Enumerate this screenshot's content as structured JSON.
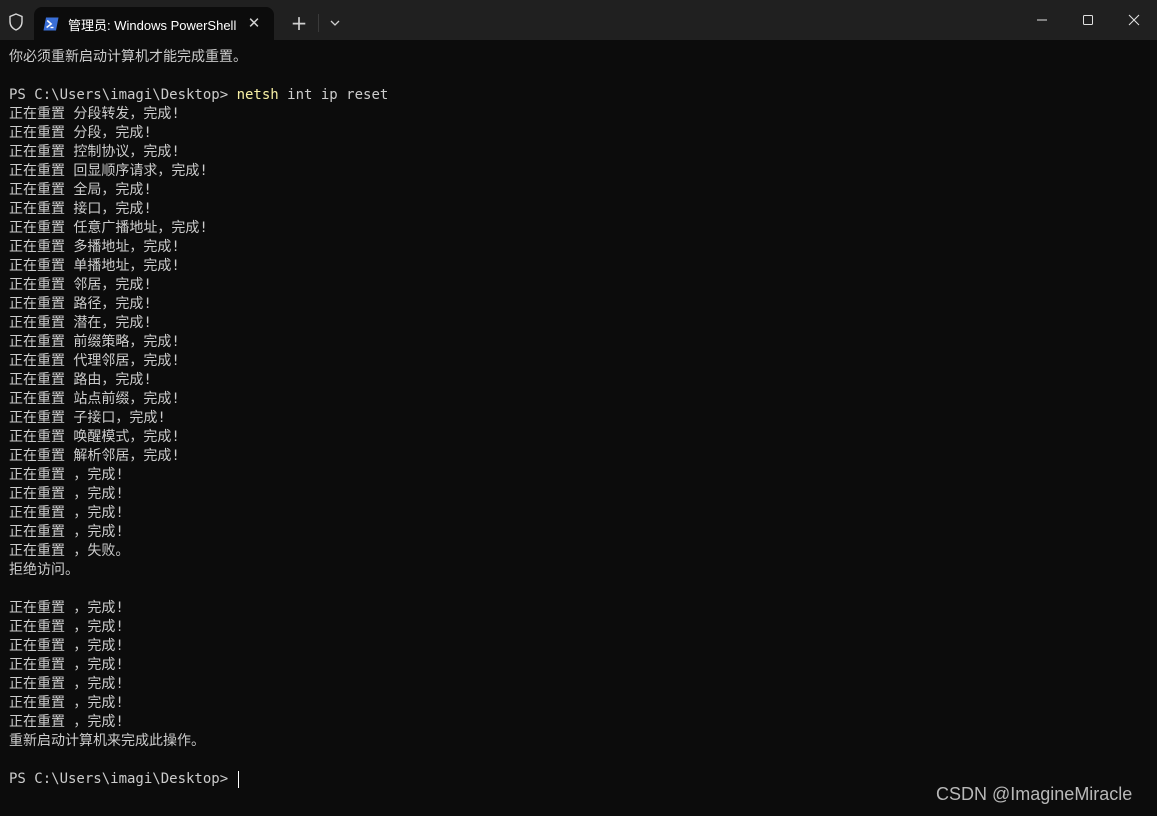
{
  "window": {
    "tab_title": "管理员: Windows PowerShell",
    "colors": {
      "titlebar": "#202020",
      "terminal_bg": "#0c0c0c",
      "text": "#cccccc",
      "command": "#f9f1a5"
    }
  },
  "terminal": {
    "lines": [
      "你必须重新启动计算机才能完成重置。",
      "",
      {
        "prompt": "PS C:\\Users\\imagi\\Desktop> ",
        "command": "netsh",
        "args": " int ip reset"
      },
      "正在重置 分段转发，完成!",
      "正在重置 分段，完成!",
      "正在重置 控制协议，完成!",
      "正在重置 回显顺序请求，完成!",
      "正在重置 全局，完成!",
      "正在重置 接口，完成!",
      "正在重置 任意广播地址，完成!",
      "正在重置 多播地址，完成!",
      "正在重置 单播地址，完成!",
      "正在重置 邻居，完成!",
      "正在重置 路径，完成!",
      "正在重置 潜在，完成!",
      "正在重置 前缀策略，完成!",
      "正在重置 代理邻居，完成!",
      "正在重置 路由，完成!",
      "正在重置 站点前缀，完成!",
      "正在重置 子接口，完成!",
      "正在重置 唤醒模式，完成!",
      "正在重置 解析邻居，完成!",
      "正在重置 ，完成!",
      "正在重置 ，完成!",
      "正在重置 ，完成!",
      "正在重置 ，完成!",
      "正在重置 ，失败。",
      "拒绝访问。",
      "",
      "正在重置 ，完成!",
      "正在重置 ，完成!",
      "正在重置 ，完成!",
      "正在重置 ，完成!",
      "正在重置 ，完成!",
      "正在重置 ，完成!",
      "正在重置 ，完成!",
      "重新启动计算机来完成此操作。",
      "",
      {
        "prompt": "PS C:\\Users\\imagi\\Desktop> ",
        "command": "",
        "args": "",
        "cursor": true
      }
    ]
  },
  "watermark": "CSDN @ImagineMiracle"
}
